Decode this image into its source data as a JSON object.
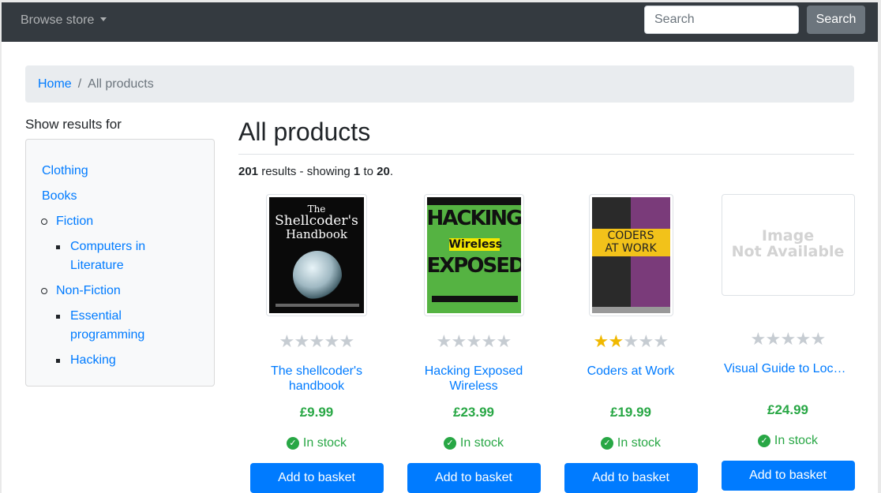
{
  "navbar": {
    "browse_label": "Browse store",
    "search_placeholder": "Search",
    "search_button": "Search"
  },
  "breadcrumb": {
    "home": "Home",
    "separator": "/",
    "current": "All products"
  },
  "sidebar": {
    "title": "Show results for",
    "items": [
      {
        "label": "Clothing"
      },
      {
        "label": "Books"
      },
      {
        "label": "Fiction"
      },
      {
        "label": "Computers in"
      },
      {
        "label": "Literature"
      },
      {
        "label": "Non-Fiction"
      },
      {
        "label": "Essential"
      },
      {
        "label": "programming"
      },
      {
        "label": "Hacking"
      }
    ]
  },
  "main": {
    "title": "All products",
    "results_count": "201",
    "results_text": "results - showing",
    "from": "1",
    "to_word": "to",
    "to": "20",
    "period": "."
  },
  "products": [
    {
      "title": "The shellcoder's handbook",
      "price": "£9.99",
      "stock": "In stock",
      "button": "Add to basket",
      "rating": 0
    },
    {
      "title": "Hacking Exposed Wireless",
      "price": "£23.99",
      "stock": "In stock",
      "button": "Add to basket",
      "rating": 0
    },
    {
      "title": "Coders at Work",
      "price": "£19.99",
      "stock": "In stock",
      "button": "Add to basket",
      "rating": 2
    },
    {
      "title": "Visual Guide to Lock ...",
      "price": "£24.99",
      "stock": "In stock",
      "button": "Add to basket",
      "rating": 0
    }
  ],
  "covers": {
    "shellcoder": {
      "line1": "The",
      "line2": "Shellcoder's",
      "line3": "Handbook"
    },
    "hacking": {
      "line1": "HACKING",
      "line2": "Wireless",
      "line3": "EXPOSED"
    },
    "coders": {
      "line1": "CODERS",
      "line2": "AT WORK"
    },
    "placeholder": {
      "line1": "Image",
      "line2": "Not Available"
    }
  },
  "colors": {
    "navbar": "#343a40",
    "link": "#007bff",
    "price": "#28a745",
    "star_on": "#f0b800",
    "star_off": "#c6ccd2"
  }
}
